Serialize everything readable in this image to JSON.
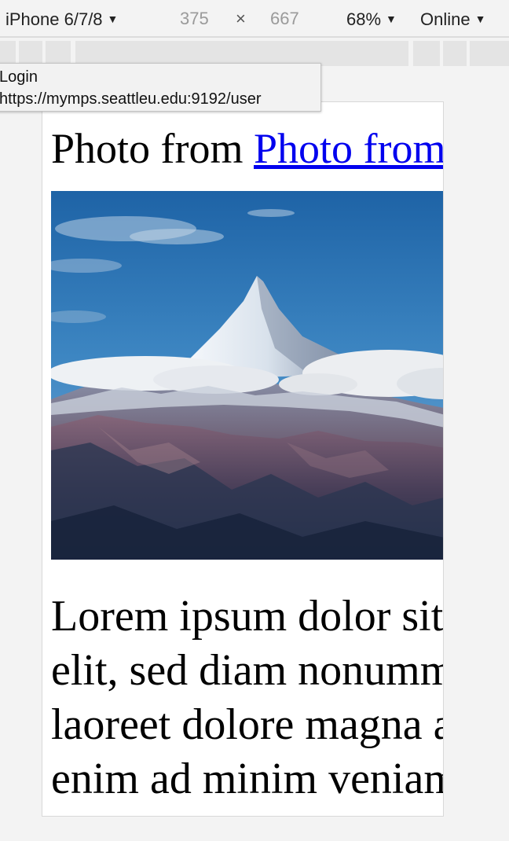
{
  "toolbar": {
    "device": "iPhone 6/7/8",
    "width": "375",
    "times": "×",
    "height": "667",
    "zoom": "68%",
    "network": "Online",
    "caret": "▼"
  },
  "tooltip": {
    "title": "Login",
    "url": "https://mymps.seattleu.edu:9192/user"
  },
  "page": {
    "heading_text": "Photo from ",
    "heading_link": "Photo from",
    "paragraph_lines": [
      "Lorem ipsum dolor sit amet, consectetuer adipiscing",
      "elit, sed diam nonummy nibh euismod tincidunt ut",
      "laoreet dolore magna aliquam erat volutpat. Ut wisi",
      "enim ad minim veniam, quis nostrud exerci tation"
    ]
  },
  "colors": {
    "link": "#0000ee",
    "sky": "#2a6fae",
    "background": "#f3f3f3"
  }
}
